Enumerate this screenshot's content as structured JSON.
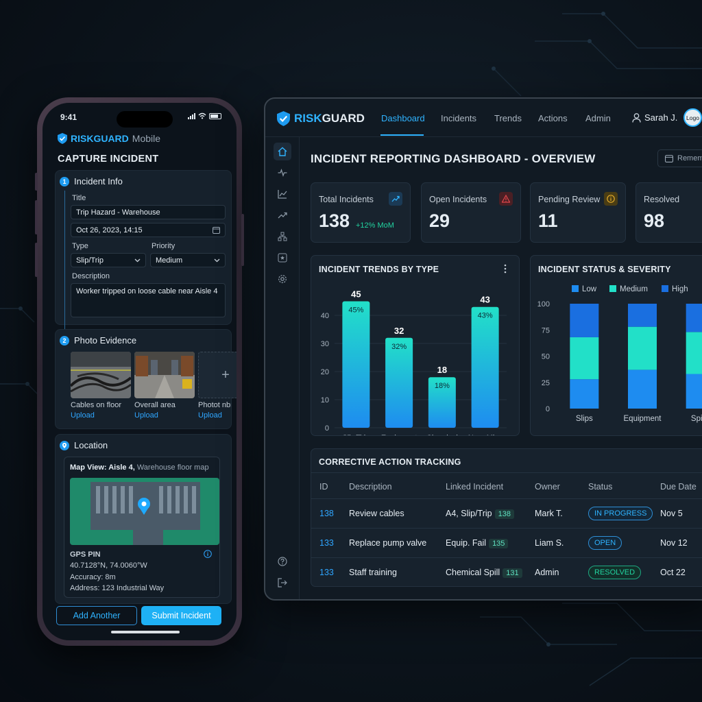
{
  "colors": {
    "accent": "#2fb3ff",
    "teal": "#22e0c8",
    "blue": "#1e8cf0",
    "danger": "#e0464b",
    "warning": "#e0a92a",
    "success": "#22d3a0"
  },
  "mobile": {
    "status_time": "9:41",
    "brand_bold": "RISKGUARD",
    "brand_light": "Mobile",
    "screen_title": "CAPTURE INCIDENT",
    "step1": {
      "num": "1",
      "title": "Incident Info",
      "title_label": "Title",
      "title_value": "Trip Hazard - Warehouse",
      "datetime_value": "Oct 26, 2023, 14:15",
      "type_label": "Type",
      "type_value": "Slip/Trip",
      "priority_label": "Priority",
      "priority_value": "Medium",
      "description_label": "Description",
      "description_value": "Worker tripped on loose cable near Aisle 4"
    },
    "step2": {
      "num": "2",
      "title": "Photo Evidence",
      "photos": [
        {
          "caption": "Cables on floor",
          "action": "Upload"
        },
        {
          "caption": "Overall area",
          "action": "Upload"
        },
        {
          "caption": "Photot nbr",
          "action": "Upload"
        }
      ],
      "add_icon": "plus-icon"
    },
    "step3": {
      "title": "Location",
      "map_title_bold": "Map View: Aisle 4,",
      "map_title_light": "Warehouse floor map",
      "gps_label": "GPS PIN",
      "coords": "40.7128°N, 74.0060°W",
      "accuracy": "Accuracy: 8m",
      "address": "Address: 123 Industrial Way"
    },
    "buttons": {
      "add_another": "Add Another",
      "submit": "Submit Incident"
    }
  },
  "dashboard": {
    "brand": {
      "risk": "RISK",
      "guard": "GUARD"
    },
    "nav": [
      "Dashboard",
      "Incidents",
      "Trends",
      "Actions",
      "Admin"
    ],
    "user_name": "Sarah J.",
    "logo_text": "Logo",
    "page_title": "INCIDENT REPORTING DASHBOARD - OVERVIEW",
    "date_button": "Remember",
    "kpis": [
      {
        "label": "Total Incidents",
        "value": "138",
        "delta": "+12% MoM",
        "icon": "trend-icon"
      },
      {
        "label": "Open Incidents",
        "value": "29",
        "icon": "warning-icon"
      },
      {
        "label": "Pending Review",
        "value": "11",
        "icon": "info-icon"
      },
      {
        "label": "Resolved",
        "value": "98",
        "icon": "check-icon"
      }
    ],
    "trends_panel_title": "INCIDENT TRENDS BY TYPE",
    "status_panel_title": "INCIDENT STATUS & SEVERITY",
    "table": {
      "title": "CORRECTIVE ACTION TRACKING",
      "headers": [
        "ID",
        "Description",
        "Linked Incident",
        "Owner",
        "Status",
        "Due Date"
      ],
      "rows": [
        {
          "id": "138",
          "description": "Review cables",
          "linked": "A4, Slip/Trip",
          "linked_tag": "138",
          "owner": "Mark T.",
          "status": "IN PROGRESS",
          "due": "Nov 5"
        },
        {
          "id": "133",
          "description": "Replace pump valve",
          "linked": "Equip. Fail",
          "linked_tag": "135",
          "owner": "Liam S.",
          "status": "OPEN",
          "due": "Nov 12"
        },
        {
          "id": "133",
          "description": "Staff training",
          "linked": "Chemical Spill",
          "linked_tag": "131",
          "owner": "Admin",
          "status": "RESOLVED",
          "due": "Oct 22"
        }
      ]
    }
  },
  "chart_data": [
    {
      "type": "bar",
      "title": "INCIDENT TRENDS BY TYPE",
      "categories": [
        "Slip/Trip",
        "Equipment Failure",
        "Chemical Spill",
        "Near Miss"
      ],
      "values": [
        45,
        32,
        18,
        43
      ],
      "data_labels_pct": [
        "45%",
        "32%",
        "18%",
        "43%"
      ],
      "yticks": [
        0,
        10,
        20,
        30,
        40
      ],
      "ylim": [
        0,
        50
      ],
      "grid": true
    },
    {
      "type": "bar",
      "stacked": true,
      "title": "INCIDENT STATUS & SEVERITY",
      "categories": [
        "Slips",
        "Equipment",
        "Spills"
      ],
      "series": [
        {
          "name": "Low",
          "color": "#1e8cf0",
          "values": [
            28,
            37,
            33
          ]
        },
        {
          "name": "Medium",
          "color": "#22e0c8",
          "values": [
            40,
            41,
            40
          ]
        },
        {
          "name": "High",
          "color": "#1a6fe0",
          "values": [
            32,
            22,
            27
          ]
        }
      ],
      "yticks": [
        0,
        25,
        50,
        75,
        100
      ],
      "ylim": [
        0,
        100
      ],
      "legend": "top"
    }
  ]
}
